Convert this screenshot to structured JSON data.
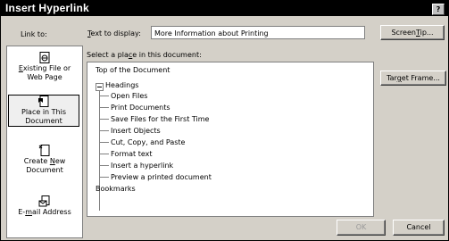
{
  "title": "Insert Hyperlink",
  "help_label": "?",
  "link_to_label": "Link to:",
  "places": [
    {
      "key": "existing",
      "pre": "",
      "u": "E",
      "rest": "xisting File or",
      "line2": "Web Page"
    },
    {
      "key": "place",
      "pre": "Place in This",
      "u": "",
      "rest": "",
      "line2": "Document"
    },
    {
      "key": "create",
      "pre": "Create ",
      "u": "N",
      "rest": "ew",
      "line2": "Document"
    },
    {
      "key": "email",
      "pre": "E-",
      "u": "m",
      "rest": "ail Address",
      "line2": ""
    }
  ],
  "text_to_display": {
    "pre": "",
    "u": "T",
    "rest": "ext to display:",
    "value": "More Information about Printing"
  },
  "screentip": {
    "pre": "Screen",
    "u": "T",
    "rest": "ip..."
  },
  "select_place": {
    "pre": "Select a pla",
    "u": "c",
    "rest": "e in this document:"
  },
  "tree": {
    "top": "Top of the Document",
    "headings": "Headings",
    "children": [
      "Open Files",
      "Print Documents",
      "Save Files for the First Time",
      "Insert Objects",
      "Cut, Copy, and Paste",
      "Format text",
      "Insert a hyperlink",
      "Preview a printed document"
    ],
    "bookmarks": "Bookmarks"
  },
  "target_frame": {
    "pre": "Tar",
    "u": "g",
    "rest": "et Frame..."
  },
  "ok_label": "OK",
  "cancel_label": "Cancel"
}
